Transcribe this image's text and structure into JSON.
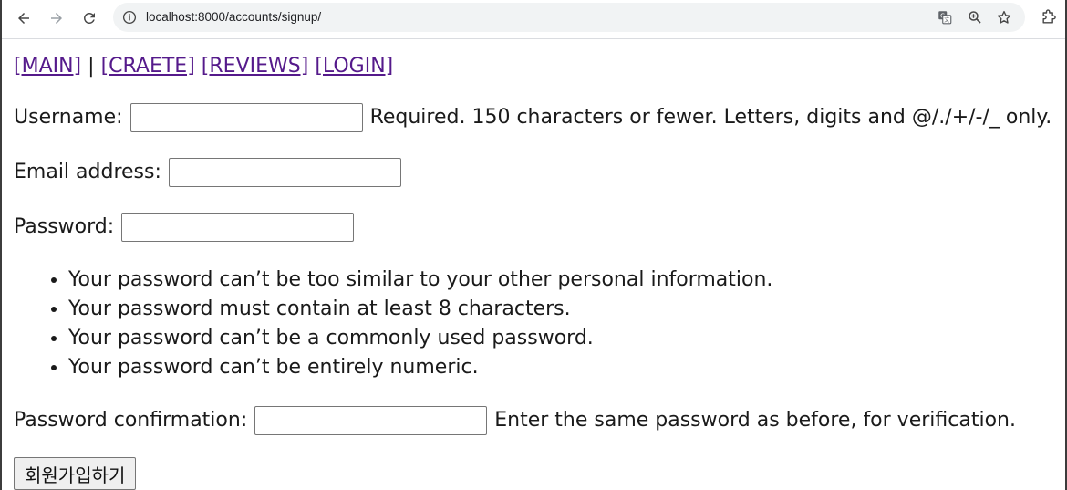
{
  "browser": {
    "url": "localhost:8000/accounts/signup/",
    "icons": {
      "back": "arrow-left-icon",
      "forward": "arrow-right-icon",
      "reload": "reload-icon",
      "site_info": "info-icon",
      "translate": "translate-icon",
      "zoom": "zoom-icon",
      "bookmark": "star-icon",
      "extensions": "puzzle-icon"
    }
  },
  "nav": {
    "main": "[MAIN]",
    "separator": "|",
    "create": "[CRAETE]",
    "reviews": "[REVIEWS]",
    "login": "[LOGIN]"
  },
  "form": {
    "username": {
      "label": "Username:",
      "value": "",
      "help": "Required. 150 characters or fewer. Letters, digits and @/./+/-/_ only."
    },
    "email": {
      "label": "Email address:",
      "value": ""
    },
    "password": {
      "label": "Password:",
      "value": "",
      "rules": [
        "Your password can’t be too similar to your other personal information.",
        "Your password must contain at least 8 characters.",
        "Your password can’t be a commonly used password.",
        "Your password can’t be entirely numeric."
      ]
    },
    "password_confirmation": {
      "label": "Password confirmation:",
      "value": "",
      "help": "Enter the same password as before, for verification."
    },
    "submit_label": "회원가입하기"
  },
  "colors": {
    "link_visited": "#551a8b",
    "omnibox_bg": "#f1f3f4",
    "text": "#1a1a1a"
  }
}
